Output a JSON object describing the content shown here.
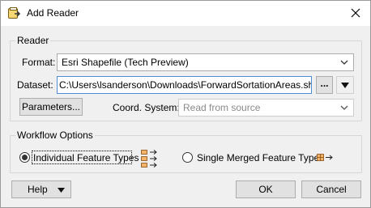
{
  "window": {
    "title": "Add Reader"
  },
  "reader": {
    "group_label": "Reader",
    "format_label": "Format:",
    "format_value": "Esri Shapefile (Tech Preview)",
    "dataset_label": "Dataset:",
    "dataset_value_before_caret": "C:\\Users\\lsanderson\\Downloads\\",
    "dataset_value_after_caret": "ForwardSortationAreas.shp",
    "browse_label": "...",
    "parameters_label": "Parameters...",
    "coord_label": "Coord. System:",
    "coord_placeholder": "Read from source"
  },
  "workflow": {
    "group_label": "Workflow Options",
    "option1_label": "Individual Feature Types",
    "option2_label": "Single Merged Feature Type",
    "selected": "option1"
  },
  "footer": {
    "help_label": "Help",
    "ok_label": "OK",
    "cancel_label": "Cancel"
  }
}
